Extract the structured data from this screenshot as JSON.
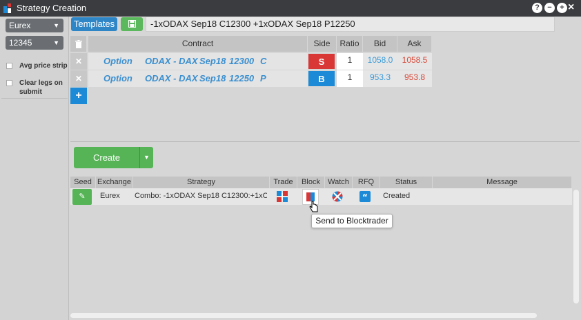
{
  "window": {
    "title": "Strategy Creation",
    "controls": [
      "?",
      "−",
      "+",
      "×"
    ]
  },
  "left": {
    "exchange": "Eurex",
    "account": "12345",
    "checkboxes": [
      {
        "label": "Avg price strip",
        "checked": false
      },
      {
        "label": "Clear legs on submit",
        "checked": false
      }
    ]
  },
  "toolbar": {
    "templates_label": "Templates",
    "strategy_name": "-1xODAX Sep18 C12300 +1xODAX Sep18 P12250"
  },
  "legs": {
    "headers": {
      "contract": "Contract",
      "side": "Side",
      "ratio": "Ratio",
      "bid": "Bid",
      "ask": "Ask"
    },
    "rows": [
      {
        "type": "Option",
        "product": "ODAX - DAX",
        "expiry": "Sep18",
        "strike": "12300",
        "cp": "C",
        "side": "S",
        "ratio": "1",
        "bid": "1058.0",
        "ask": "1058.5"
      },
      {
        "type": "Option",
        "product": "ODAX - DAX",
        "expiry": "Sep18",
        "strike": "12250",
        "cp": "P",
        "side": "B",
        "ratio": "1",
        "bid": "953.3",
        "ask": "953.8"
      }
    ]
  },
  "actions": {
    "create_label": "Create"
  },
  "strategies": {
    "headers": {
      "seed": "Seed",
      "exchange": "Exchange",
      "strategy": "Strategy",
      "trade": "Trade",
      "block": "Block",
      "watch": "Watch",
      "rfq": "RFQ",
      "status": "Status",
      "message": "Message"
    },
    "rows": [
      {
        "exchange": "Eurex",
        "strategy": "Combo: -1xODAX Sep18 C12300:+1xO...",
        "status": "Created",
        "message": ""
      }
    ]
  },
  "tooltip": {
    "text": "Send to Blocktrader"
  },
  "colors": {
    "titlebar": "#3a3c3f",
    "blue": "#1c8ad6",
    "green": "#56b456",
    "sell_red": "#d93636"
  }
}
